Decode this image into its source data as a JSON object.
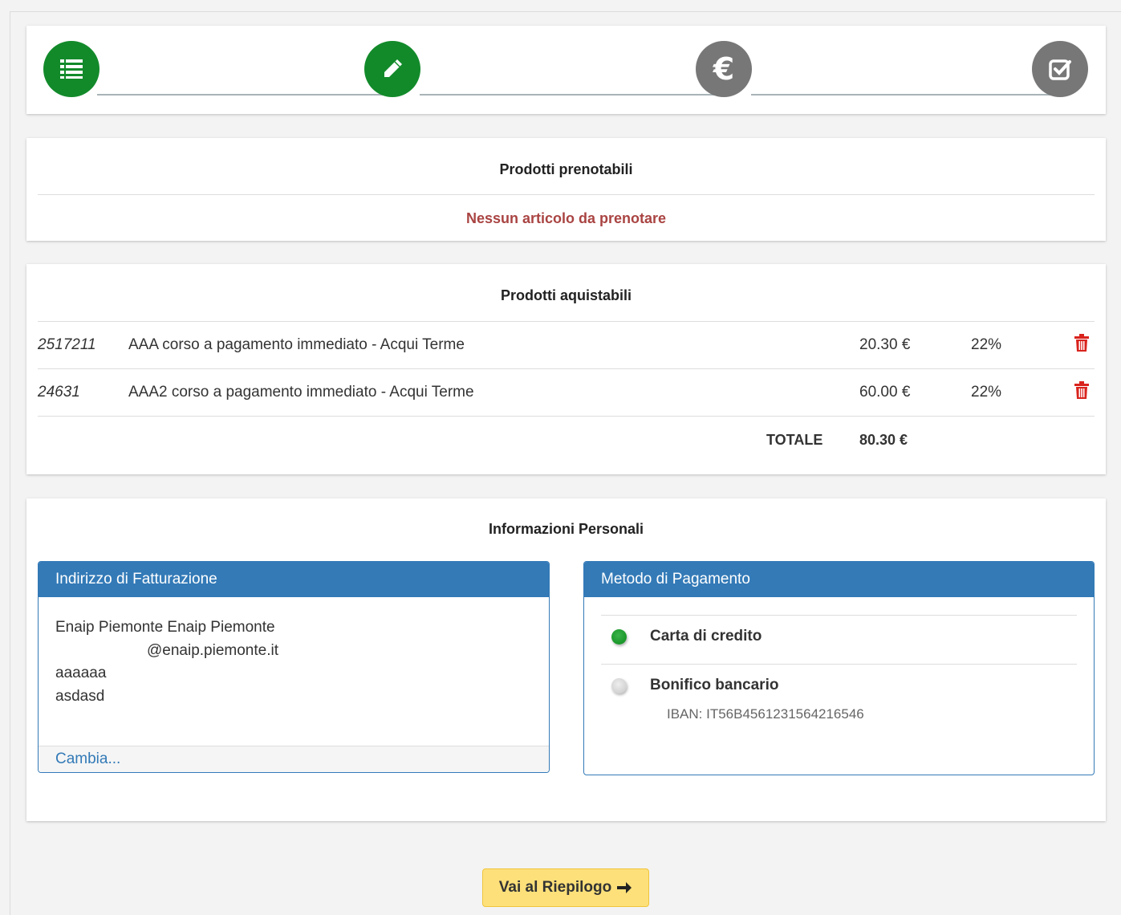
{
  "stepper": {
    "steps": [
      {
        "icon": "list-icon",
        "state": "done"
      },
      {
        "icon": "pencil-icon",
        "state": "done"
      },
      {
        "icon": "euro-icon",
        "state": "todo",
        "glyph": "€"
      },
      {
        "icon": "check-square-icon",
        "state": "todo"
      }
    ],
    "colors": {
      "done": "#128a2a",
      "todo": "#777777"
    }
  },
  "bookable": {
    "title": "Prodotti prenotabili",
    "empty_message": "Nessun articolo da prenotare"
  },
  "purchasable": {
    "title": "Prodotti aquistabili",
    "rows": [
      {
        "code": "2517211",
        "name": "AAA corso a pagamento immediato - Acqui Terme",
        "price": "20.30 €",
        "vat": "22%"
      },
      {
        "code": "24631",
        "name": "AAA2 corso a pagamento immediato - Acqui Terme",
        "price": "60.00 €",
        "vat": "22%"
      }
    ],
    "total_label": "TOTALE",
    "total_value": "80.30 €"
  },
  "personal": {
    "title": "Informazioni Personali",
    "billing": {
      "header": "Indirizzo di Fatturazione",
      "lines": [
        "Enaip Piemonte Enaip Piemonte",
        "@enaip.piemonte.it",
        "aaaaaa",
        "asdasd"
      ],
      "change_link": "Cambia..."
    },
    "payment": {
      "header": "Metodo di Pagamento",
      "options": [
        {
          "label": "Carta di credito",
          "selected": true
        },
        {
          "label": "Bonifico bancario",
          "selected": false,
          "detail": "IBAN: IT56B4561231564216546"
        }
      ]
    }
  },
  "actions": {
    "summary_button": "Vai al Riepilogo",
    "summary_icon": "arrow-right-icon"
  },
  "colors": {
    "accent_blue": "#337ab7",
    "error_red": "#a94442",
    "button_yellow": "#fde07a",
    "trash_red": "#d9231d"
  }
}
